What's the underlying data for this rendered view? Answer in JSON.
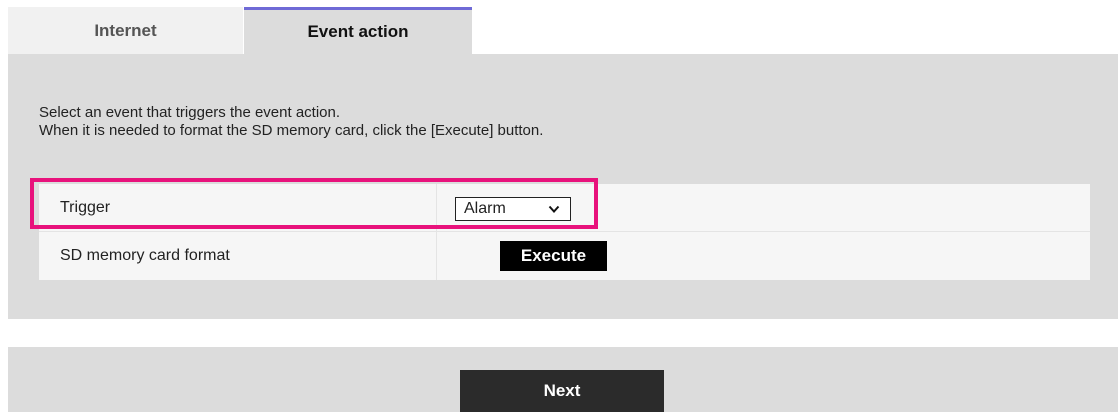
{
  "tabs": {
    "internet_label": "Internet",
    "event_action_label": "Event action",
    "active": "Event action",
    "active_accent_color": "#6f6ad6"
  },
  "description": {
    "line1": "Select an event that triggers the event action.",
    "line2": "When it is needed to format the SD memory card, click the [Execute] button."
  },
  "settings": {
    "trigger": {
      "label": "Trigger",
      "selected_value": "Alarm",
      "icon": "chevron-down-icon"
    },
    "sd_format": {
      "label": "SD memory card format",
      "button_label": "Execute"
    }
  },
  "highlight": {
    "color": "#e8127c",
    "target": "Trigger"
  },
  "footer": {
    "next_label": "Next"
  }
}
